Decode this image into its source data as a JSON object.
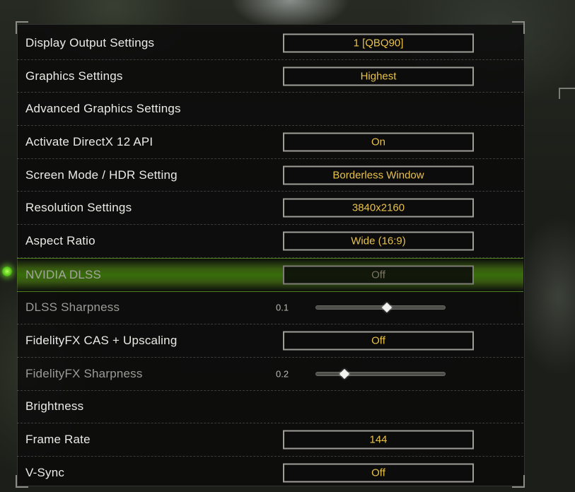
{
  "settings": {
    "rows": [
      {
        "label": "Display Output Settings",
        "value": "1 [QBQ90]"
      },
      {
        "label": "Graphics Settings",
        "value": "Highest"
      },
      {
        "label": "Advanced Graphics Settings"
      },
      {
        "label": "Activate DirectX 12 API",
        "value": "On"
      },
      {
        "label": "Screen Mode / HDR Setting",
        "value": "Borderless Window"
      },
      {
        "label": "Resolution Settings",
        "value": "3840x2160"
      },
      {
        "label": "Aspect Ratio",
        "value": "Wide (16:9)"
      },
      {
        "label": "NVIDIA DLSS",
        "value": "Off"
      },
      {
        "label": "DLSS Sharpness",
        "slider_value": "0.1",
        "slider_fraction": 0.55
      },
      {
        "label": "FidelityFX CAS + Upscaling",
        "value": "Off"
      },
      {
        "label": "FidelityFX Sharpness",
        "slider_value": "0.2",
        "slider_fraction": 0.22
      },
      {
        "label": "Brightness"
      },
      {
        "label": "Frame Rate",
        "value": "144"
      },
      {
        "label": "V-Sync",
        "value": "Off"
      }
    ],
    "selected_index": 7
  },
  "colors": {
    "value_text": "#e8c24a",
    "highlight": "#5aa81a"
  }
}
